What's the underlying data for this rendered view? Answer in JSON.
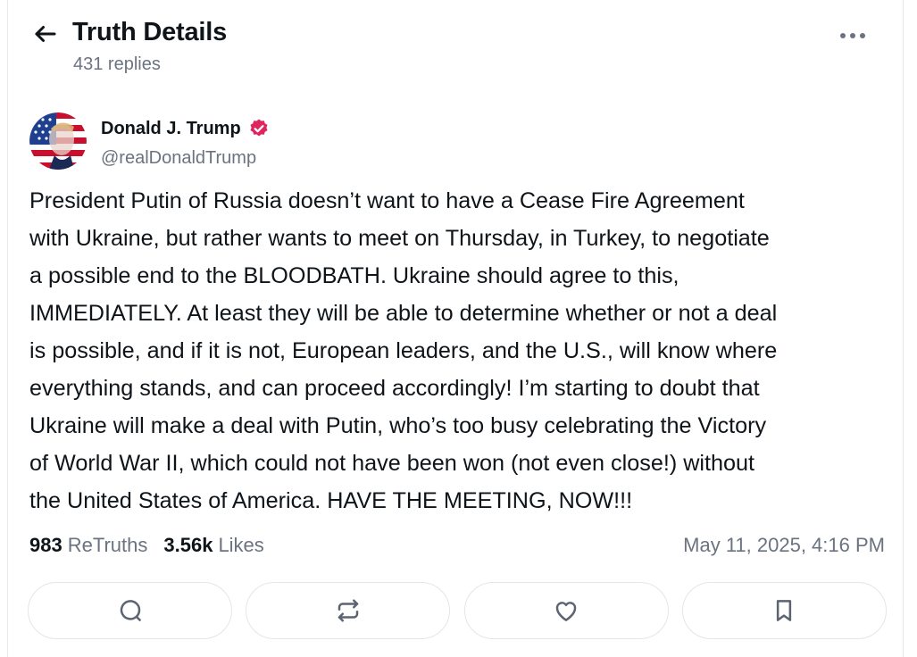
{
  "header": {
    "title": "Truth Details",
    "replies": "431 replies",
    "back_icon": "arrow-left-icon",
    "more_icon": "more-horizontal-icon"
  },
  "author": {
    "name": "Donald J. Trump",
    "handle": "@realDonaldTrump",
    "verified_color": "#e0245e"
  },
  "post": {
    "text": "President Putin of Russia doesn’t want to have a Cease Fire Agreement\nwith Ukraine, but rather wants to meet on Thursday, in Turkey, to negotiate\na possible end to the BLOODBATH. Ukraine should agree to this,\nIMMEDIATELY. At least they will be able to determine whether or not a deal\nis possible, and if it is not, European leaders, and the U.S., will know where\neverything stands, and can proceed accordingly! I’m starting to doubt that\nUkraine will make a deal with Putin, who’s too busy celebrating the Victory\nof World War II, which could not have been won (not even close!) without\nthe United States of America. HAVE THE MEETING, NOW!!!"
  },
  "stats": {
    "retruths_count": "983",
    "retruths_label": "ReTruths",
    "likes_count": "3.56k",
    "likes_label": "Likes",
    "timestamp": "May 11, 2025, 4:16 PM"
  },
  "actions": [
    {
      "icon": "reply-icon"
    },
    {
      "icon": "retruth-icon"
    },
    {
      "icon": "like-icon"
    },
    {
      "icon": "bookmark-icon"
    }
  ]
}
